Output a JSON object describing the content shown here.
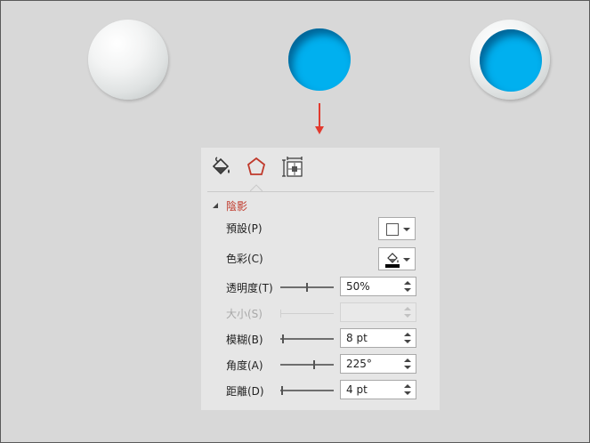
{
  "colors": {
    "accent_red": "#c0392b",
    "circle_blue": "#00b0ef",
    "panel_bg": "#e6e6e6",
    "page_bg": "#d8d8d8"
  },
  "canvas": {
    "circles": [
      "white-sphere",
      "blue-inner-shadow-circle",
      "blue-circle-in-white-ring"
    ],
    "arrow_icon": "down-arrow-red"
  },
  "panel": {
    "tabs": [
      {
        "icon": "fill-bucket-icon",
        "active": false
      },
      {
        "icon": "pentagon-effects-icon",
        "active": true
      },
      {
        "icon": "size-properties-icon",
        "active": false
      }
    ],
    "section": {
      "title": "陰影",
      "expanded": true
    },
    "rows": {
      "preset": {
        "label": "預設(P)",
        "value_icon": "blank-shadow-preset-icon"
      },
      "color": {
        "label": "色彩(C)",
        "value_icon": "paint-bucket-black-icon"
      },
      "transparency": {
        "label": "透明度(T)",
        "value": "50%",
        "level": 0.5
      },
      "size": {
        "label": "大小(S)",
        "value": "",
        "disabled": true
      },
      "blur": {
        "label": "模糊(B)",
        "value": "8 pt"
      },
      "angle": {
        "label": "角度(A)",
        "value": "225°",
        "level": 0.625
      },
      "distance": {
        "label": "距離(D)",
        "value": "4 pt"
      }
    }
  }
}
